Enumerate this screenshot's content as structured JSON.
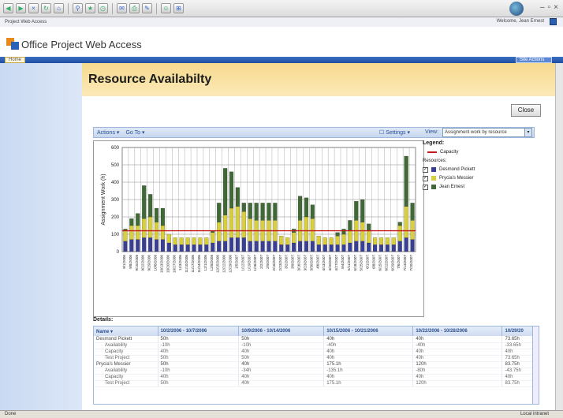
{
  "browser": {
    "tab_title": "Project Web Access",
    "welcome": "Welcome, Jean Ernest"
  },
  "app": {
    "logo_text": "Office Project Web Access",
    "home_tab": "Home",
    "site_actions": "Site Actions"
  },
  "page": {
    "title": "Resource Availabilty",
    "close_label": "Close"
  },
  "toolbar": {
    "actions": "Actions",
    "goto": "Go To",
    "settings": "Settings",
    "view_label": "View:",
    "view_value": "Assignment work by resource"
  },
  "legend": {
    "title": "Legend:",
    "capacity": "Capacity",
    "resources_label": "Resources:",
    "items": [
      {
        "name": "Desmond Pickett",
        "color": "#3a3f96"
      },
      {
        "name": "Prycia's Messier",
        "color": "#d9cf3a"
      },
      {
        "name": "Jean Ernest",
        "color": "#3f6a35"
      }
    ]
  },
  "chart_data": {
    "type": "bar",
    "stacked": true,
    "ylabel": "Assignment Work (h)",
    "ylim": [
      0,
      600
    ],
    "yticks": [
      0,
      100,
      200,
      300,
      400,
      500,
      600
    ],
    "categories": [
      "9/1/2006",
      "9/8/2006",
      "9/15/2006",
      "9/22/2006",
      "9/29/2006",
      "10/6/2006",
      "10/13/2006",
      "10/20/2006",
      "10/27/2006",
      "11/3/2006",
      "11/10/2006",
      "11/17/2006",
      "11/24/2006",
      "12/1/2006",
      "12/8/2006",
      "12/15/2006",
      "12/22/2006",
      "12/29/2006",
      "1/5/2007",
      "1/12/2007",
      "1/19/2007",
      "1/26/2007",
      "2/2/2007",
      "2/9/2007",
      "2/16/2007",
      "2/23/2007",
      "3/2/2007",
      "3/9/2007",
      "3/16/2007",
      "3/23/2007",
      "3/30/2007",
      "4/6/2007",
      "4/13/2007",
      "4/20/2007",
      "4/27/2007",
      "5/4/2007",
      "5/11/2007",
      "5/18/2007",
      "5/25/2007",
      "6/1/2007",
      "6/8/2007",
      "6/15/2007",
      "6/22/2007",
      "6/29/2007",
      "7/6/2007",
      "7/13/2007",
      "7/20/2007"
    ],
    "series": [
      {
        "name": "Desmond Pickett",
        "values": [
          60,
          70,
          70,
          80,
          80,
          70,
          70,
          50,
          40,
          40,
          40,
          40,
          40,
          40,
          50,
          60,
          60,
          80,
          80,
          80,
          60,
          60,
          60,
          60,
          60,
          40,
          40,
          50,
          60,
          60,
          60,
          40,
          40,
          40,
          40,
          40,
          50,
          60,
          60,
          50,
          40,
          40,
          40,
          40,
          60,
          80,
          70
        ]
      },
      {
        "name": "Prycia's Messier",
        "values": [
          60,
          80,
          80,
          110,
          120,
          100,
          80,
          50,
          40,
          40,
          40,
          40,
          40,
          40,
          60,
          110,
          150,
          170,
          180,
          150,
          130,
          120,
          120,
          120,
          120,
          50,
          40,
          60,
          120,
          140,
          130,
          50,
          40,
          40,
          50,
          60,
          70,
          120,
          110,
          70,
          40,
          40,
          40,
          40,
          90,
          180,
          110
        ]
      },
      {
        "name": "Jean Ernest",
        "values": [
          10,
          40,
          70,
          190,
          130,
          80,
          100,
          0,
          0,
          0,
          0,
          0,
          0,
          0,
          10,
          110,
          270,
          210,
          110,
          50,
          90,
          100,
          100,
          100,
          100,
          0,
          0,
          20,
          140,
          110,
          80,
          0,
          0,
          0,
          20,
          30,
          60,
          110,
          130,
          40,
          0,
          0,
          0,
          0,
          20,
          290,
          100
        ]
      }
    ],
    "capacity": 120,
    "grid": true
  },
  "details": {
    "label": "Details:",
    "columns": [
      "Name",
      "10/2/2006 - 10/7/2006",
      "10/9/2006 - 10/14/2006",
      "10/15/2006 - 10/21/2006",
      "10/22/2006 - 10/28/2006",
      "10/29/20"
    ],
    "rows": [
      {
        "cells": [
          "Desmond Pickett",
          "50h",
          "50h",
          "40h",
          "40h",
          "73.65h"
        ],
        "sub": false
      },
      {
        "cells": [
          "Availability",
          "-10h",
          "-10h",
          "-40h",
          "-40h",
          "-33.65h"
        ],
        "sub": true
      },
      {
        "cells": [
          "Capacity",
          "40h",
          "40h",
          "40h",
          "40h",
          "40h"
        ],
        "sub": true
      },
      {
        "cells": [
          "Test Project",
          "50h",
          "50h",
          "40h",
          "40h",
          "73.65h"
        ],
        "sub": true
      },
      {
        "cells": [
          "Prycia's Messier",
          "50h",
          "40h",
          "175.1h",
          "120h",
          "83.75h"
        ],
        "sub": false
      },
      {
        "cells": [
          "Availability",
          "-10h",
          "-34h",
          "-135.1h",
          "-80h",
          "-43.75h"
        ],
        "sub": true
      },
      {
        "cells": [
          "Capacity",
          "40h",
          "40h",
          "40h",
          "40h",
          "40h"
        ],
        "sub": true
      },
      {
        "cells": [
          "Test Project",
          "50h",
          "40h",
          "175.1h",
          "120h",
          "83.75h"
        ],
        "sub": true
      }
    ]
  },
  "status": {
    "left": "Done",
    "right": "Local intranet"
  }
}
